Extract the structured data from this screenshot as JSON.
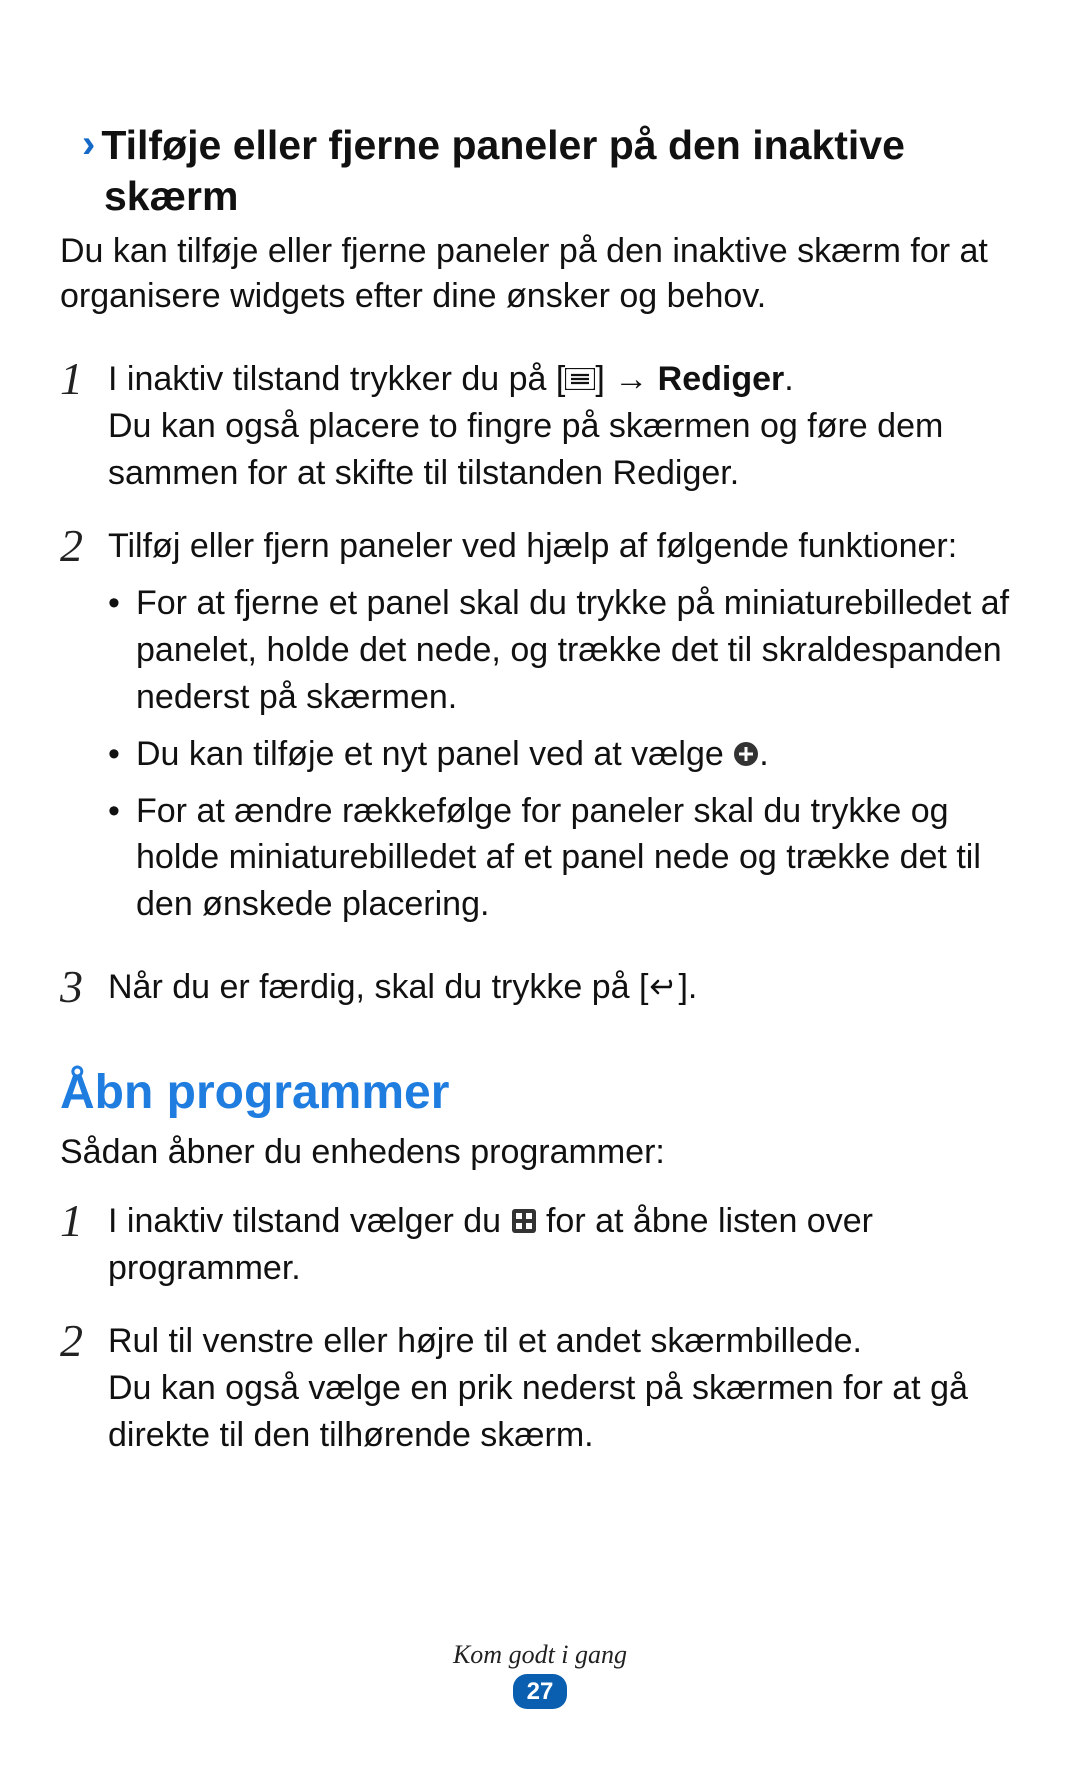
{
  "section_sub": {
    "line1_prefix": "Tilføje eller fjerne paneler på den inaktive",
    "line2": "skærm"
  },
  "intro": "Du kan tilføje eller fjerne paneler på den inaktive skærm for at organisere widgets efter dine ønsker og behov.",
  "step1": {
    "part_a": "I inaktiv tilstand trykker du på [",
    "part_b": "] → ",
    "bold": "Rediger",
    "part_c": ".",
    "sub": "Du kan også placere to fingre på skærmen og føre dem sammen for at skifte til tilstanden Rediger."
  },
  "step2": {
    "lead": "Tilføj eller fjern paneler ved hjælp af følgende funktioner:",
    "bullets": {
      "b1": "For at fjerne et panel skal du trykke på miniaturebilledet af panelet, holde det nede, og trække det til skraldespanden nederst på skærmen.",
      "b2_a": "Du kan tilføje et nyt panel ved at vælge ",
      "b2_b": ".",
      "b3": "For at ændre rækkefølge for paneler skal du trykke og holde miniaturebilledet af et panel nede og trække det til den ønskede placering."
    }
  },
  "step3": {
    "part_a": "Når du er færdig, skal du trykke på [",
    "part_b": "]."
  },
  "section_title": "Åbn programmer",
  "open_intro": "Sådan åbner du enhedens programmer:",
  "open_step1": {
    "part_a": "I inaktiv tilstand vælger du ",
    "part_b": " for at åbne listen over programmer."
  },
  "open_step2": {
    "line1": "Rul til venstre eller højre til et andet skærmbillede.",
    "line2": "Du kan også vælge en prik nederst på skærmen for at gå direkte til den tilhørende skærm."
  },
  "footer": {
    "text": "Kom godt i gang",
    "page": "27"
  }
}
